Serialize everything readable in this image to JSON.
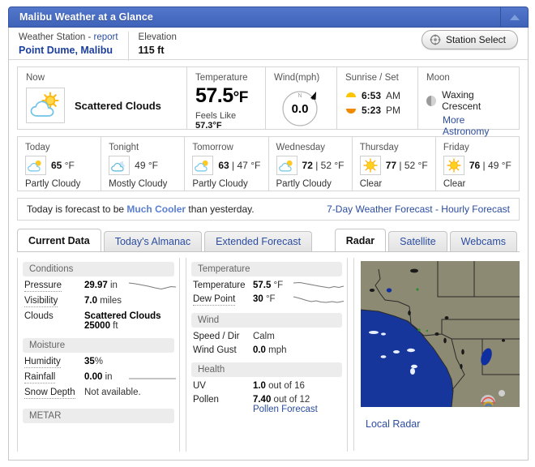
{
  "window": {
    "title": "Malibu Weather at a Glance",
    "collapse_icon": "triangle-up-icon",
    "header_color": "#4a6fc4"
  },
  "station": {
    "label_prefix": "Weather Station - ",
    "report_link": "report",
    "name": "Point Dume, Malibu",
    "elevation_label": "Elevation",
    "elevation_value": "115 ft",
    "select_button": "Station Select"
  },
  "now": {
    "heading": "Now",
    "condition": "Scattered Clouds",
    "icon": "partly-cloudy-icon",
    "temperature": {
      "heading": "Temperature",
      "value": "57.5",
      "unit": "°F",
      "feels_like_label": "Feels Like",
      "feels_like_value": "57.3",
      "feels_like_unit": "°F"
    },
    "wind": {
      "heading": "Wind(mph)",
      "value": "0.0",
      "north_label": "N",
      "direction_deg": 48
    },
    "sun": {
      "heading": "Sunrise / Set",
      "sunrise": "6:53",
      "sunrise_period": "AM",
      "sunset": "5:23",
      "sunset_period": "PM"
    },
    "moon": {
      "heading": "Moon",
      "phase": "Waxing Crescent",
      "link": "More Astronomy"
    }
  },
  "forecast": [
    {
      "day": "Today",
      "icon": "partly-cloudy-icon",
      "high": "65",
      "low": "",
      "unit": "°F",
      "desc": "Partly Cloudy"
    },
    {
      "day": "Tonight",
      "icon": "mostly-cloudy-night-icon",
      "high": "49",
      "low": "",
      "unit": "°F",
      "desc": "Mostly Cloudy"
    },
    {
      "day": "Tomorrow",
      "icon": "partly-cloudy-icon",
      "high": "63",
      "low": "47",
      "unit": "°F",
      "desc": "Partly Cloudy"
    },
    {
      "day": "Wednesday",
      "icon": "partly-cloudy-icon",
      "high": "72",
      "low": "52",
      "unit": "°F",
      "desc": "Partly Cloudy"
    },
    {
      "day": "Thursday",
      "icon": "sunny-icon",
      "high": "77",
      "low": "52",
      "unit": "°F",
      "desc": "Clear"
    },
    {
      "day": "Friday",
      "icon": "sunny-icon",
      "high": "76",
      "low": "49",
      "unit": "°F",
      "desc": "Clear"
    }
  ],
  "summary": {
    "prefix": "Today is forecast to be ",
    "highlight": "Much Cooler",
    "suffix": " than yesterday.",
    "links": "7-Day Weather Forecast - Hourly Forecast"
  },
  "tabs_left": [
    {
      "label": "Current Data",
      "active": true
    },
    {
      "label": "Today's Almanac",
      "active": false
    },
    {
      "label": "Extended Forecast",
      "active": false
    }
  ],
  "tabs_right": [
    {
      "label": "Radar",
      "active": true
    },
    {
      "label": "Satellite",
      "active": false
    },
    {
      "label": "Webcams",
      "active": false
    }
  ],
  "panel_left": {
    "sections": [
      {
        "title": "Conditions",
        "rows": [
          {
            "key": "Pressure",
            "dotted": true,
            "value": "29.97",
            "value_unit": " in",
            "spark": true
          },
          {
            "key": "Visibility",
            "dotted": true,
            "value": "7.0",
            "value_unit": " miles",
            "spark": false
          },
          {
            "key": "Clouds",
            "dotted": false,
            "value": "Scattered Clouds",
            "value_unit": "",
            "value2": "25000",
            "value2_unit": " ft",
            "spark": false
          }
        ]
      },
      {
        "title": "Moisture",
        "rows": [
          {
            "key": "Humidity",
            "dotted": true,
            "value": "35",
            "value_unit": "%",
            "spark": false
          },
          {
            "key": "Rainfall",
            "dotted": true,
            "value": "0.00",
            "value_unit": " in",
            "spark": true
          },
          {
            "key": "Snow Depth",
            "dotted": true,
            "value": "",
            "value_unit": "Not available.",
            "spark": false
          }
        ]
      },
      {
        "title": "METAR",
        "rows": []
      }
    ]
  },
  "panel_mid": {
    "sections": [
      {
        "title": "Temperature",
        "rows": [
          {
            "key": "Temperature",
            "dotted": false,
            "value": "57.5",
            "value_unit": " °F",
            "spark": true
          },
          {
            "key": "Dew Point",
            "dotted": true,
            "value": "30",
            "value_unit": " °F",
            "spark": true
          }
        ]
      },
      {
        "title": "Wind",
        "rows": [
          {
            "key": "Speed / Dir",
            "dotted": false,
            "value": "",
            "value_unit": "Calm",
            "spark": false
          },
          {
            "key": "Wind Gust",
            "dotted": false,
            "value": "0.0",
            "value_unit": " mph",
            "spark": false
          }
        ]
      },
      {
        "title": "Health",
        "rows": [
          {
            "key": "UV",
            "dotted": false,
            "value": "1.0",
            "value_unit": " out of 16",
            "spark": false
          },
          {
            "key": "Pollen",
            "dotted": false,
            "value": "7.40",
            "value_unit": " out of 12",
            "link": "Pollen Forecast",
            "spark": false
          }
        ]
      }
    ]
  },
  "radar": {
    "link": "Local Radar",
    "land_color": "#8d8a74",
    "ocean_color": "#17369c"
  }
}
